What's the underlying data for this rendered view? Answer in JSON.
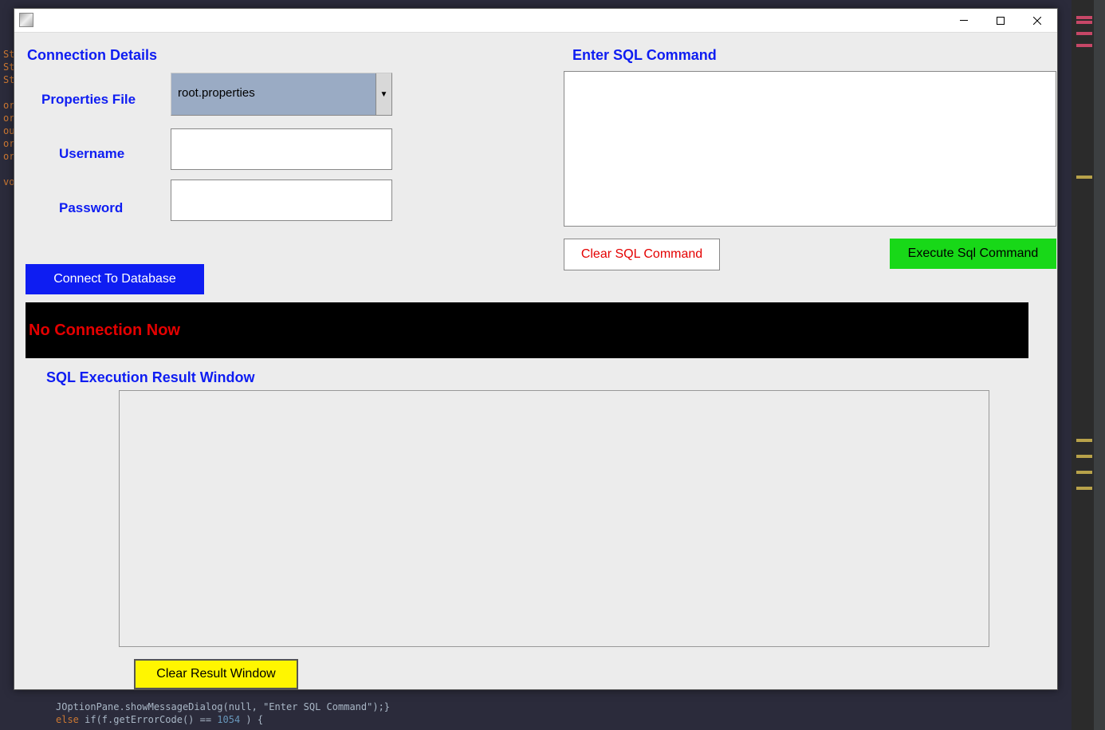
{
  "headers": {
    "connection_details": "Connection Details",
    "enter_sql": "Enter SQL Command",
    "result_window": "SQL Execution Result Window"
  },
  "labels": {
    "properties_file": "Properties File",
    "username": "Username",
    "password": "Password"
  },
  "fields": {
    "properties_file_value": "root.properties",
    "username_value": "",
    "password_value": "",
    "sql_command_value": ""
  },
  "buttons": {
    "connect": "Connect To Database",
    "clear_sql": "Clear SQL Command",
    "execute": "Execute Sql Command",
    "clear_result": "Clear Result Window"
  },
  "status": {
    "text": "No Connection Now"
  },
  "window_controls": {
    "minimize": "–",
    "maximize": "☐",
    "close": "✕"
  },
  "background_code": {
    "line1": "JOptionPane.showMessageDialog(null, \"Enter SQL Command\");}",
    "line2": "else if(f.getErrorCode() == 1054 ) {"
  }
}
